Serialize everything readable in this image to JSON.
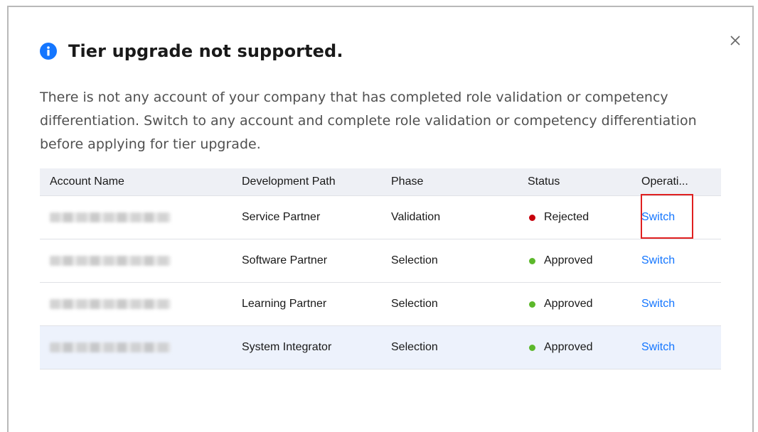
{
  "dialog": {
    "title": "Tier upgrade not supported.",
    "description": "There is not any account of your company that has completed role validation or competency differentiation. Switch to any account and complete role validation or competency differentiation before applying for tier upgrade.",
    "close_icon": "close-icon",
    "info_icon": "info-icon"
  },
  "table": {
    "headers": [
      "Account Name",
      "Development Path",
      "Phase",
      "Status",
      "Operati..."
    ],
    "rows": [
      {
        "path": "Service Partner",
        "phase": "Validation",
        "status": "Rejected",
        "status_color": "#c7000b",
        "operation": "Switch"
      },
      {
        "path": "Software Partner",
        "phase": "Selection",
        "status": "Approved",
        "status_color": "#5cb82b",
        "operation": "Switch"
      },
      {
        "path": "Learning Partner",
        "phase": "Selection",
        "status": "Approved",
        "status_color": "#5cb82b",
        "operation": "Switch"
      },
      {
        "path": "System Integrator",
        "phase": "Selection",
        "status": "Approved",
        "status_color": "#5cb82b",
        "operation": "Switch"
      }
    ]
  },
  "colors": {
    "link": "#1476ff",
    "highlight": "#e02020",
    "header_bg": "#eef0f5"
  }
}
